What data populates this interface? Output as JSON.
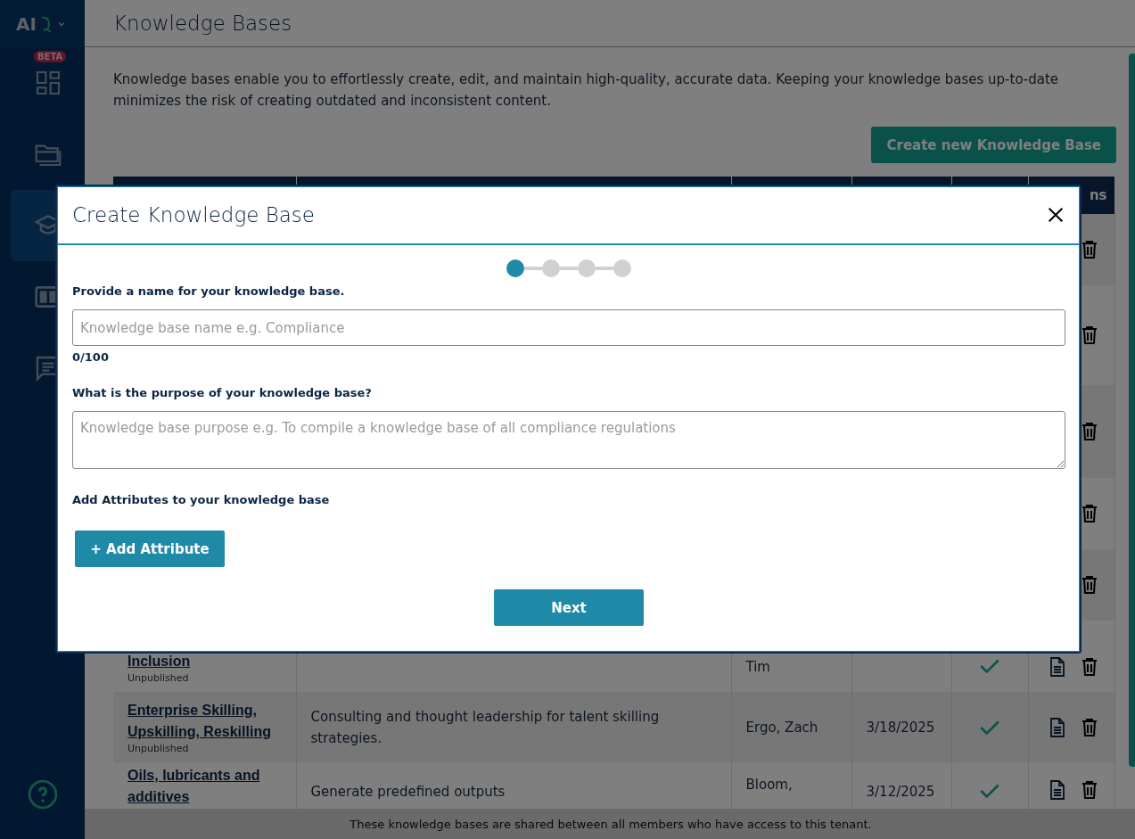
{
  "sidebar": {
    "logo": "AI",
    "items": [
      {
        "badge": "BETA",
        "selected": false
      },
      {
        "selected": false
      },
      {
        "selected": true
      },
      {
        "selected": false
      },
      {
        "selected": false
      }
    ]
  },
  "page": {
    "title": "Knowledge Bases",
    "description": "Knowledge bases enable you to effortlessly create, edit, and maintain high-quality, accurate data. Keeping your knowledge bases up-to-date minimizes the risk of creating outdated and inconsistent content.",
    "create_button": "Create new Knowledge Base"
  },
  "table": {
    "column_6": "ns",
    "rows": [
      {
        "kind": "covered"
      },
      {
        "kind": "covered"
      },
      {
        "kind": "covered"
      },
      {
        "kind": "covered"
      },
      {
        "kind": "covered"
      },
      {
        "kind": "partial",
        "name": "Inclusion",
        "status": "Unpublished",
        "author": "Tim",
        "published": true
      },
      {
        "kind": "full",
        "name": "Enterprise Skilling, Upskilling, Reskilling",
        "status": "Unpublished",
        "description": "Consulting and thought leadership for talent skilling strategies.",
        "author": "Ergo, Zach",
        "date": "3/18/2025",
        "published": true
      },
      {
        "kind": "full",
        "name": "Oils, lubricants and additives",
        "description": "Generate predefined outputs",
        "author": "Bloom,",
        "date": "3/12/2025",
        "published": true
      }
    ]
  },
  "footer": "These knowledge bases are shared between all members who have access to this tenant.",
  "modal": {
    "title": "Create Knowledge Base",
    "steps": [
      {
        "active": true
      },
      {
        "active": false
      },
      {
        "active": false
      },
      {
        "active": false
      }
    ],
    "name_label": "Provide a name for your knowledge base.",
    "name_placeholder": "Knowledge base name e.g. Compliance",
    "name_counter": "0/100",
    "purpose_label": "What is the purpose of your knowledge base?",
    "purpose_placeholder": "Knowledge base purpose e.g. To compile a knowledge base of all compliance regulations",
    "attributes_label": "Add Attributes to your knowledge base",
    "add_button": "+ Add Attribute",
    "next_button": "Next"
  }
}
